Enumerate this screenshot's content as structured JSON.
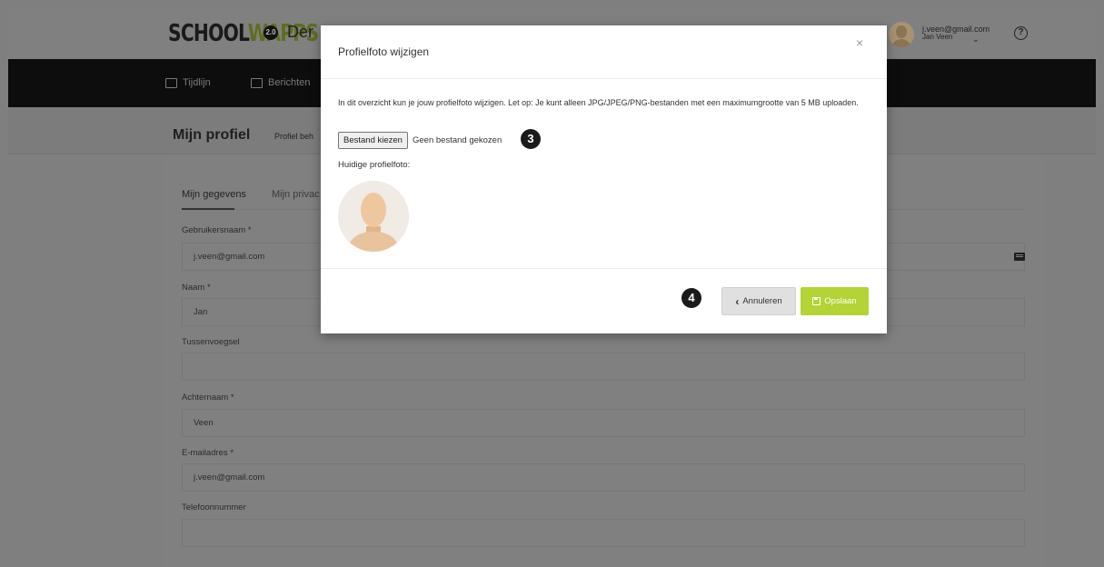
{
  "header": {
    "logo_left": "SCHOOL",
    "logo_right": "WAPPS",
    "logo_version": "2.0",
    "site_partial": "Der",
    "user_email": "j.veen@gmail.com",
    "user_name": "Jan Veen",
    "help": "?"
  },
  "nav": {
    "items": [
      {
        "label": "Tijdlijn",
        "icon": "calendar-icon"
      },
      {
        "label": "Berichten",
        "icon": "envelope-icon"
      }
    ]
  },
  "page": {
    "title": "Mijn profiel",
    "sub_tab": "Profiel beh"
  },
  "profile": {
    "tabs": [
      "Mijn gegevens",
      "Mijn privac"
    ],
    "fields": [
      {
        "label": "Gebruikersnaam *",
        "value": "j.veen@gmail.com"
      },
      {
        "label": "Naam *",
        "value": "Jan"
      },
      {
        "label": "Tussenvoegsel",
        "value": ""
      },
      {
        "label": "Achternaam *",
        "value": "Veen"
      },
      {
        "label": "E-mailadres *",
        "value": "j.veen@gmail.com"
      },
      {
        "label": "Telefoonnummer",
        "value": ""
      }
    ]
  },
  "modal": {
    "title": "Profielfoto wijzigen",
    "close": "×",
    "description": "In dit overzicht kun je jouw profielfoto wijzigen. Let op: Je kunt alleen JPG/JPEG/PNG-bestanden met een maximumgrootte van 5 MB uploaden.",
    "file_button": "Bestand kiezen",
    "file_status": "Geen bestand gekozen",
    "current_label": "Huidige profielfoto:",
    "cancel_label": "Annuleren",
    "save_label": "Opslaan",
    "step_badges": [
      "3",
      "4"
    ]
  },
  "colors": {
    "save_accent": "#b4d334",
    "navbar": "#0d0d0d"
  }
}
